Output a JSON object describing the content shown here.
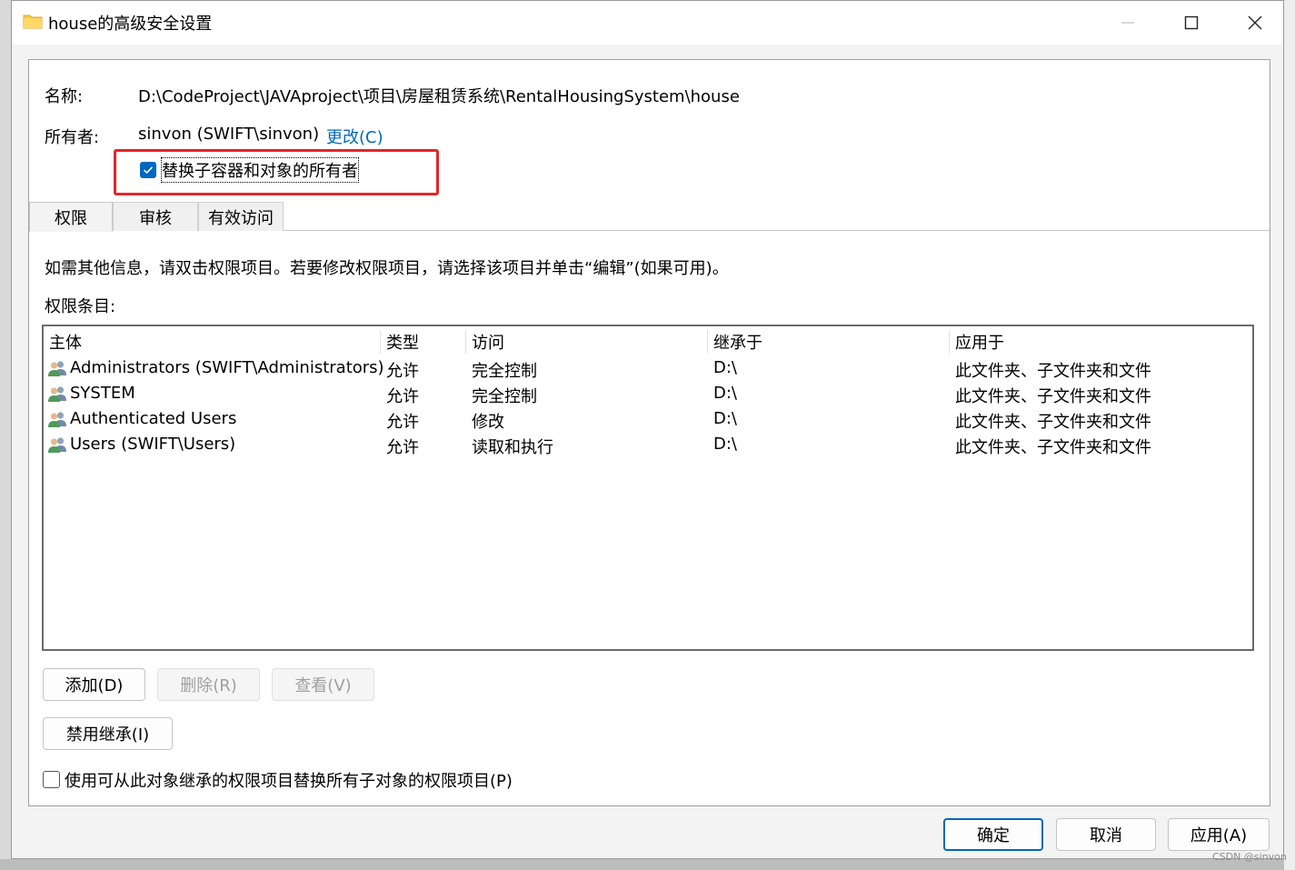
{
  "window": {
    "title": "house的高级安全设置",
    "controls": {
      "minimize": "minimize-icon",
      "maximize": "maximize-icon",
      "close": "close-icon"
    }
  },
  "info": {
    "name_label": "名称:",
    "name_value": "D:\\CodeProject\\JAVAproject\\项目\\房屋租赁系统\\RentalHousingSystem\\house",
    "owner_label": "所有者:",
    "owner_value": "sinvon (SWIFT\\sinvon)",
    "change_link": "更改(C)",
    "replace_owner_checkbox": {
      "label": "替换子容器和对象的所有者",
      "checked": true
    }
  },
  "tabs": [
    {
      "label": "权限",
      "active": true
    },
    {
      "label": "审核",
      "active": false
    },
    {
      "label": "有效访问",
      "active": false
    }
  ],
  "permissions": {
    "instruction": "如需其他信息，请双击权限项目。若要修改权限项目，请选择该项目并单击“编辑”(如果可用)。",
    "entries_label": "权限条目:",
    "columns": [
      "主体",
      "类型",
      "访问",
      "继承于",
      "应用于"
    ],
    "rows": [
      {
        "principal": "Administrators (SWIFT\\Administrators)",
        "type": "允许",
        "access": "完全控制",
        "inherited_from": "D:\\",
        "applies_to": "此文件夹、子文件夹和文件"
      },
      {
        "principal": "SYSTEM",
        "type": "允许",
        "access": "完全控制",
        "inherited_from": "D:\\",
        "applies_to": "此文件夹、子文件夹和文件"
      },
      {
        "principal": "Authenticated Users",
        "type": "允许",
        "access": "修改",
        "inherited_from": "D:\\",
        "applies_to": "此文件夹、子文件夹和文件"
      },
      {
        "principal": "Users (SWIFT\\Users)",
        "type": "允许",
        "access": "读取和执行",
        "inherited_from": "D:\\",
        "applies_to": "此文件夹、子文件夹和文件"
      }
    ]
  },
  "buttons": {
    "add": "添加(D)",
    "remove": "删除(R)",
    "view": "查看(V)",
    "disable_inheritance": "禁用继承(I)",
    "ok": "确定",
    "cancel": "取消",
    "apply": "应用(A)"
  },
  "replace_child_checkbox": {
    "label": "使用可从此对象继承的权限项目替换所有子对象的权限项目(P)",
    "checked": false
  },
  "watermark": "CSDN @sinvon",
  "colors": {
    "accent": "#0067c0",
    "highlight": "#e4262b"
  }
}
